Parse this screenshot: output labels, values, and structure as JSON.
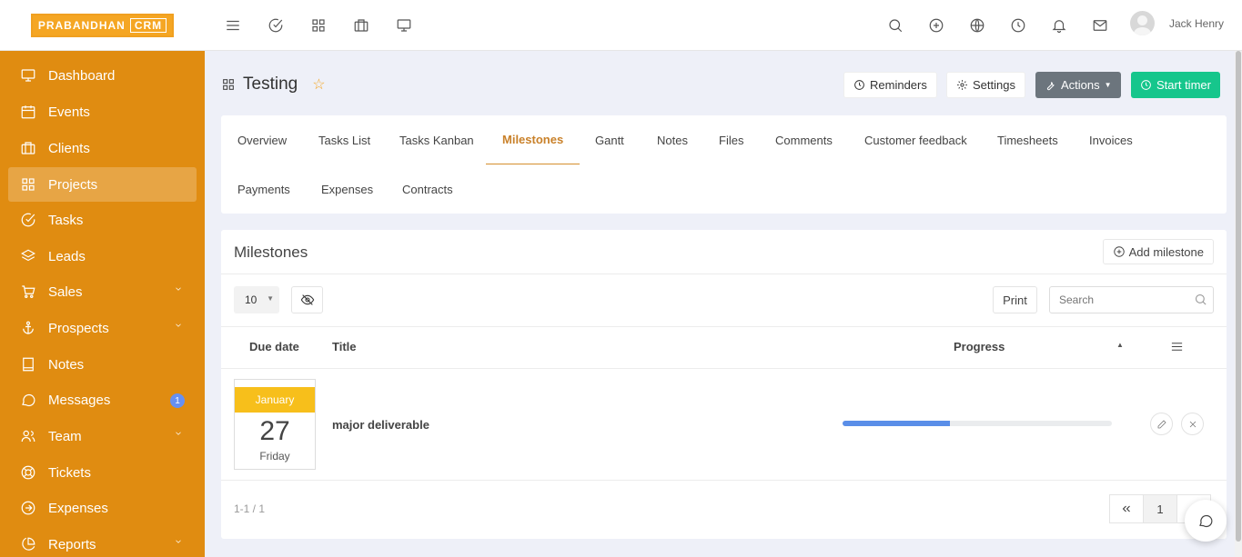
{
  "brand": {
    "logo_text": "PRABANDHAN",
    "logo_badge": "CRM",
    "accent": "#e08c11"
  },
  "topbar": {
    "left_icons": [
      "menu-icon",
      "check-circle-icon",
      "apps-grid-icon",
      "briefcase-icon",
      "monitor-icon"
    ],
    "right_icons": [
      "search-icon",
      "plus-circle-icon",
      "globe-icon",
      "clock-icon",
      "bell-icon",
      "mail-icon"
    ],
    "user_name": "Jack Henry"
  },
  "sidebar": {
    "items": [
      {
        "label": "Dashboard",
        "icon": "monitor-icon"
      },
      {
        "label": "Events",
        "icon": "calendar-icon"
      },
      {
        "label": "Clients",
        "icon": "briefcase-icon"
      },
      {
        "label": "Projects",
        "icon": "grid-icon",
        "active": true
      },
      {
        "label": "Tasks",
        "icon": "check-circle-icon"
      },
      {
        "label": "Leads",
        "icon": "layers-icon"
      },
      {
        "label": "Sales",
        "icon": "cart-icon",
        "expandable": true
      },
      {
        "label": "Prospects",
        "icon": "anchor-icon",
        "expandable": true
      },
      {
        "label": "Notes",
        "icon": "book-icon"
      },
      {
        "label": "Messages",
        "icon": "message-icon",
        "badge": "1"
      },
      {
        "label": "Team",
        "icon": "users-icon",
        "expandable": true
      },
      {
        "label": "Tickets",
        "icon": "life-buoy-icon"
      },
      {
        "label": "Expenses",
        "icon": "arrow-circle-icon"
      },
      {
        "label": "Reports",
        "icon": "pie-chart-icon",
        "expandable": true
      }
    ]
  },
  "header": {
    "title": "Testing",
    "reminders_label": "Reminders",
    "settings_label": "Settings",
    "actions_label": "Actions",
    "start_timer_label": "Start timer"
  },
  "tabs": {
    "row1": [
      "Overview",
      "Tasks List",
      "Tasks Kanban",
      "Milestones",
      "Gantt",
      "Notes",
      "Files",
      "Comments",
      "Customer feedback",
      "Timesheets",
      "Invoices"
    ],
    "row2": [
      "Payments",
      "Expenses",
      "Contracts"
    ],
    "active": "Milestones"
  },
  "milestones": {
    "title": "Milestones",
    "add_label": "Add milestone",
    "page_size": "10",
    "print_label": "Print",
    "search_placeholder": "Search",
    "columns": {
      "due_date": "Due date",
      "title": "Title",
      "progress": "Progress"
    },
    "rows": [
      {
        "month": "January",
        "day": "27",
        "weekday": "Friday",
        "title": "major deliverable",
        "progress": 0.4
      }
    ],
    "info": "1-1 / 1",
    "current_page": "1"
  },
  "colors": {
    "progress_fill": "#5a8ee8",
    "date_header": "#f7bf1b",
    "start_timer": "#16c68c"
  }
}
